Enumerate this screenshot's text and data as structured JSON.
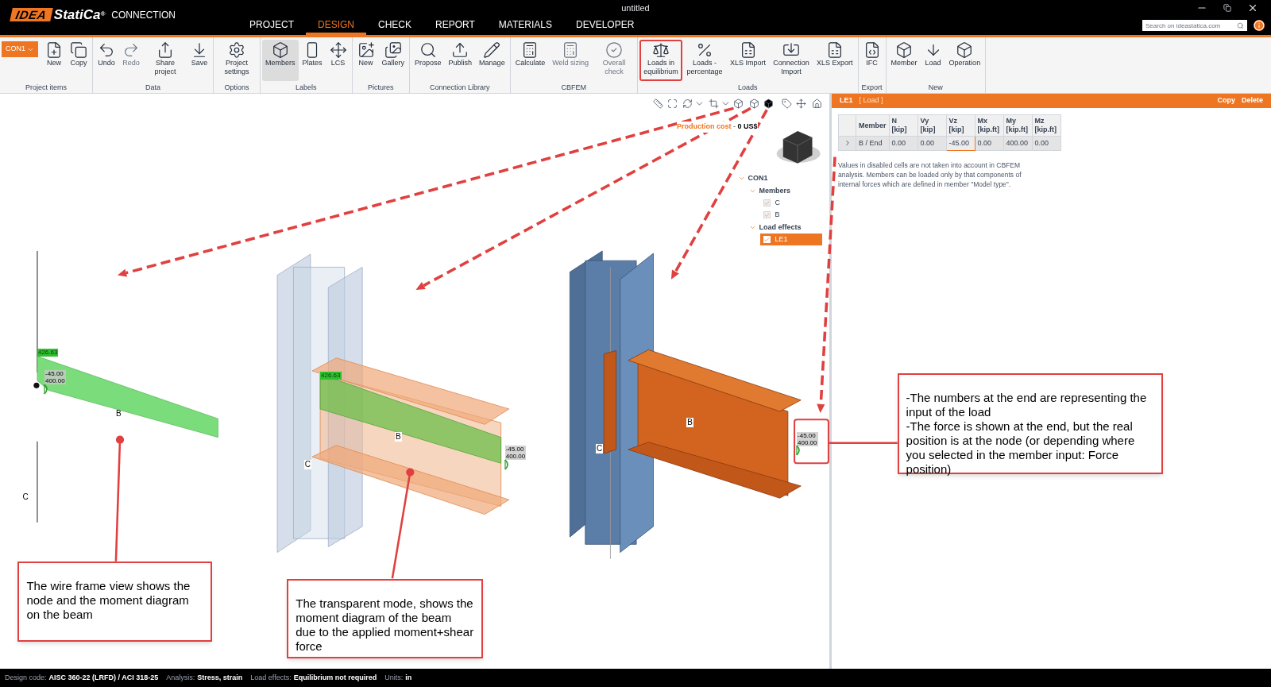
{
  "app": {
    "logo": "IDEA",
    "brand": "StatiCa",
    "registered": "®",
    "product": "CONNECTION"
  },
  "window": {
    "title": "untitled"
  },
  "menu_tabs": [
    {
      "label": "PROJECT",
      "selected": false
    },
    {
      "label": "DESIGN",
      "selected": true
    },
    {
      "label": "CHECK",
      "selected": false
    },
    {
      "label": "REPORT",
      "selected": false
    },
    {
      "label": "MATERIALS",
      "selected": false
    },
    {
      "label": "DEVELOPER",
      "selected": false
    }
  ],
  "search": {
    "placeholder": "Search on ideastatica.com"
  },
  "ribbon": {
    "connection": "CON1",
    "groups": [
      {
        "label": "Project items",
        "buttons": [
          {
            "label": "New",
            "disabled": false,
            "selected": false,
            "highlighted": false
          },
          {
            "label": "Copy",
            "disabled": false,
            "selected": false,
            "highlighted": false
          }
        ]
      },
      {
        "label": "Data",
        "buttons": [
          {
            "label": "Undo",
            "disabled": false,
            "selected": false,
            "highlighted": false
          },
          {
            "label": "Redo",
            "disabled": true,
            "selected": false,
            "highlighted": false
          },
          {
            "label": "Share project",
            "disabled": false,
            "selected": false,
            "highlighted": false
          },
          {
            "label": "Save",
            "disabled": false,
            "selected": false,
            "highlighted": false
          }
        ]
      },
      {
        "label": "Options",
        "buttons": [
          {
            "label": "Project settings",
            "disabled": false,
            "selected": false,
            "highlighted": false
          }
        ]
      },
      {
        "label": "Labels",
        "buttons": [
          {
            "label": "Members",
            "disabled": false,
            "selected": true,
            "highlighted": false
          },
          {
            "label": "Plates",
            "disabled": false,
            "selected": false,
            "highlighted": false
          },
          {
            "label": "LCS",
            "disabled": false,
            "selected": false,
            "highlighted": false
          }
        ]
      },
      {
        "label": "Pictures",
        "buttons": [
          {
            "label": "New",
            "disabled": false,
            "selected": false,
            "highlighted": false
          },
          {
            "label": "Gallery",
            "disabled": false,
            "selected": false,
            "highlighted": false
          }
        ]
      },
      {
        "label": "Connection Library",
        "buttons": [
          {
            "label": "Propose",
            "disabled": false,
            "selected": false,
            "highlighted": false
          },
          {
            "label": "Publish",
            "disabled": false,
            "selected": false,
            "highlighted": false
          },
          {
            "label": "Manage",
            "disabled": false,
            "selected": false,
            "highlighted": false
          }
        ]
      },
      {
        "label": "CBFEM",
        "buttons": [
          {
            "label": "Calculate",
            "disabled": false,
            "selected": false,
            "highlighted": false
          },
          {
            "label": "Weld sizing",
            "disabled": true,
            "selected": false,
            "highlighted": false
          },
          {
            "label": "Overall check",
            "disabled": true,
            "selected": false,
            "highlighted": false
          }
        ]
      },
      {
        "label": "Loads",
        "buttons": [
          {
            "label": "Loads in equilibrium",
            "disabled": false,
            "selected": false,
            "highlighted": true
          },
          {
            "label": "Loads - percentage",
            "disabled": false,
            "selected": false,
            "highlighted": false
          },
          {
            "label": "XLS Import",
            "disabled": false,
            "selected": false,
            "highlighted": false
          },
          {
            "label": "Connection Import",
            "disabled": false,
            "selected": false,
            "highlighted": false
          },
          {
            "label": "XLS Export",
            "disabled": false,
            "selected": false,
            "highlighted": false
          }
        ]
      },
      {
        "label": "Export",
        "buttons": [
          {
            "label": "IFC",
            "disabled": false,
            "selected": false,
            "highlighted": false
          }
        ]
      },
      {
        "label": "New",
        "buttons": [
          {
            "label": "Member",
            "disabled": false,
            "selected": false,
            "highlighted": false
          },
          {
            "label": "Load",
            "disabled": false,
            "selected": false,
            "highlighted": false
          },
          {
            "label": "Operation",
            "disabled": false,
            "selected": false,
            "highlighted": false
          }
        ]
      }
    ]
  },
  "production_cost": {
    "label": "Production cost",
    "separator": " - ",
    "value": "0 US$"
  },
  "tree": [
    {
      "label": "CON1",
      "expanded": true,
      "children": [
        {
          "label": "Members",
          "expanded": true,
          "children": [
            {
              "label": "C",
              "checked": true,
              "selected": false
            },
            {
              "label": "B",
              "checked": true,
              "selected": false
            }
          ]
        },
        {
          "label": "Load effects",
          "expanded": true,
          "children": [
            {
              "label": "LE1",
              "checked": true,
              "selected": true
            }
          ]
        }
      ]
    }
  ],
  "views": [
    {
      "kind": "wireframe",
      "member_labels": [
        "B",
        "C"
      ],
      "moment_label": "426.63",
      "load_values": [
        "-45.00",
        "400.00"
      ]
    },
    {
      "kind": "transparent",
      "member_labels": [
        "B",
        "C"
      ],
      "moment_label": "426.63",
      "load_values": [
        "-45.00",
        "400.00"
      ]
    },
    {
      "kind": "solid",
      "member_labels": [
        "B",
        "C"
      ],
      "load_values": [
        "-45.00",
        "400.00"
      ]
    }
  ],
  "callouts": [
    {
      "paragraphs": [
        "The wire frame view shows the node and the moment diagram on the beam"
      ]
    },
    {
      "paragraphs": [
        "The transparent mode, shows the moment diagram of the beam due to the applied moment+shear force"
      ]
    },
    {
      "paragraphs": [
        "-The numbers at the end are representing the input of the load",
        "-The force is shown at the end, but the real position is at the node (or depending where you selected in the member input: Force position)"
      ]
    }
  ],
  "load_panel": {
    "title": "LE1",
    "subtitle": "[ Load ]",
    "actions": [
      "Copy",
      "Delete"
    ],
    "table": {
      "columns": [
        {
          "name": "Member"
        },
        {
          "name": "N",
          "unit": "[kip]"
        },
        {
          "name": "Vy",
          "unit": "[kip]"
        },
        {
          "name": "Vz",
          "unit": "[kip]"
        },
        {
          "name": "Mx",
          "unit": "[kip.ft]"
        },
        {
          "name": "My",
          "unit": "[kip.ft]"
        },
        {
          "name": "Mz",
          "unit": "[kip.ft]"
        }
      ],
      "rows": [
        {
          "expanded": false,
          "cells": [
            {
              "text": "B / End",
              "selected": false
            },
            {
              "text": "0.00",
              "selected": false
            },
            {
              "text": "0.00",
              "selected": false
            },
            {
              "text": "-45.00",
              "selected": true
            },
            {
              "text": "0.00",
              "selected": false
            },
            {
              "text": "400.00",
              "selected": false
            },
            {
              "text": "0.00",
              "selected": false
            }
          ]
        }
      ]
    },
    "note": "Values in disabled cells are not taken into account in CBFEM analysis. Members can be loaded only by that components of internal forces which are defined in member \"Model type\"."
  },
  "status_bar": [
    {
      "label": "Design code:",
      "value": "AISC 360-22 (LRFD) / ACI 318-25"
    },
    {
      "label": "Analysis:",
      "value": "Stress, strain"
    },
    {
      "label": "Load effects:",
      "value": "Equilibrium not required"
    },
    {
      "label": "Units:",
      "value": "in"
    }
  ]
}
